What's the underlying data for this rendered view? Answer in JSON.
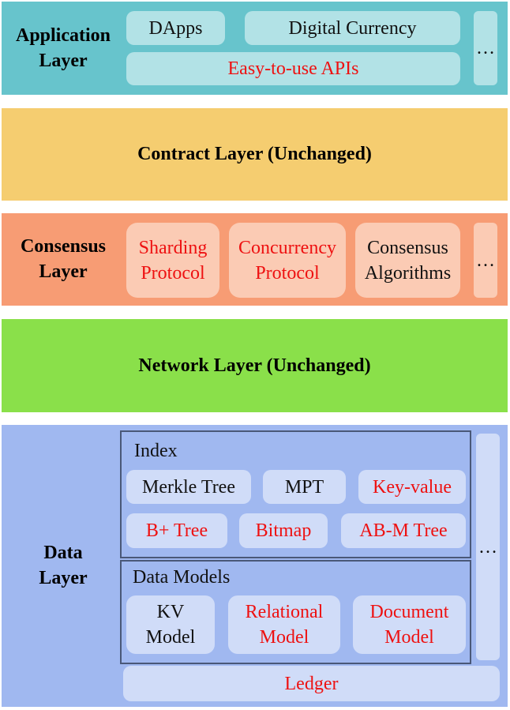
{
  "colors": {
    "application": "#67c4cc",
    "application_box": "#b2e2e6",
    "contract": "#f5cd70",
    "consensus": "#f79c74",
    "consensus_box": "#fbcbb4",
    "network": "#8ae04a",
    "data": "#a0b8f0",
    "data_box": "#d0dcf8",
    "highlight_text": "#ee1111"
  },
  "application": {
    "label": "Application\nLayer",
    "dapps": "DApps",
    "digital_currency": "Digital Currency",
    "apis": "Easy-to-use APIs",
    "more": "…"
  },
  "contract": {
    "label": "Contract Layer (Unchanged)"
  },
  "consensus": {
    "label": "Consensus\nLayer",
    "sharding": "Sharding\nProtocol",
    "concurrency": "Concurrency\nProtocol",
    "algorithms": "Consensus\nAlgorithms",
    "more": "…"
  },
  "network": {
    "label": "Network Layer (Unchanged)"
  },
  "data": {
    "label": "Data\nLayer",
    "index": {
      "title": "Index",
      "items": [
        "Merkle Tree",
        "MPT",
        "Key-value",
        "B+ Tree",
        "Bitmap",
        "AB-M Tree"
      ]
    },
    "models": {
      "title": "Data Models",
      "items": [
        "KV\nModel",
        "Relational\nModel",
        "Document\nModel"
      ]
    },
    "ledger": "Ledger",
    "more": "…"
  }
}
